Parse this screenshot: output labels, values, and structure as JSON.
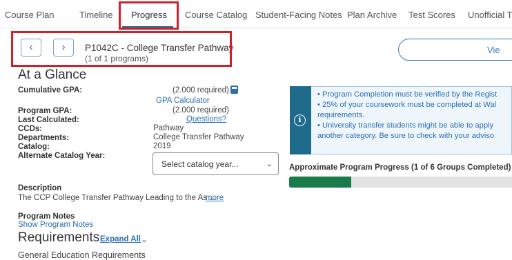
{
  "tabs": [
    {
      "label": "Course Plan"
    },
    {
      "label": "Timeline"
    },
    {
      "label": "Progress"
    },
    {
      "label": "Course Catalog"
    },
    {
      "label": "Student-Facing Notes"
    },
    {
      "label": "Plan Archive"
    },
    {
      "label": "Test Scores"
    },
    {
      "label": "Unofficial T"
    }
  ],
  "program": {
    "title": "P1042C - College Transfer Pathway",
    "subtitle": "(1 of 1 programs)",
    "prev_icon": "chevron-left-icon",
    "next_icon": "chevron-right-icon",
    "view_label": "Vie"
  },
  "glance": {
    "heading": "At a Glance",
    "cumulative_gpa_label": "Cumulative GPA:",
    "cumulative_gpa_value": "(2.000 required)",
    "gpa_calculator_link": "GPA Calculator",
    "program_gpa_label": "Program GPA:",
    "program_gpa_value": "(2.000 required)",
    "last_calculated_label": "Last Calculated:",
    "questions_link": "Questions?",
    "ccds_label": "CCDs:",
    "ccds_value": "Pathway",
    "departments_label": "Departments:",
    "departments_value": "College Transfer Pathway",
    "catalog_label": "Catalog:",
    "catalog_value": "2019",
    "alt_catalog_label": "Alternate Catalog Year:",
    "catalog_select_value": "Select catalog year...",
    "description_label": "Description",
    "description_text": "The CCP College Transfer Pathway Leading to the As ...",
    "more_link": "more",
    "program_notes_label": "Program Notes",
    "show_notes_link": "Show Program Notes"
  },
  "info": {
    "icon": "info-icon",
    "lines": [
      "• Program Completion must be verified by the Regist",
      "• 25% of your coursework must be completed at Wal",
      "requirements.",
      "• University transfer students might be able to apply",
      "another category. Be sure to check with your adviso"
    ]
  },
  "progress": {
    "label": "Approximate Program Progress (1 of 6 Groups Completed)",
    "groups_completed": 1,
    "groups_total": 6
  },
  "requirements": {
    "heading": "Requirements",
    "expand_all": "Expand All",
    "first_group": "General Education Requirements"
  },
  "colors": {
    "accent": "#1f6b8c",
    "link": "#2a6fb3",
    "progress": "#197a4a",
    "highlight": "#d0202a"
  }
}
